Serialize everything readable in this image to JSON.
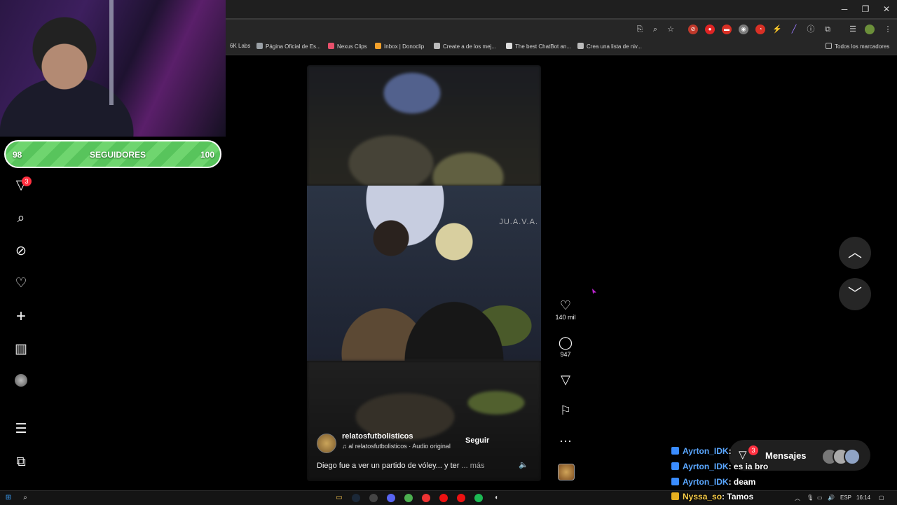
{
  "window_controls": {
    "minimize": "─",
    "maximize": "❐",
    "close": "✕"
  },
  "bookmarks": [
    {
      "label": "6K Labs",
      "color": "#777777"
    },
    {
      "label": "Página Oficial de Es...",
      "color": "#9aa0a6"
    },
    {
      "label": "Nexus Clips",
      "color": "#e8506b"
    },
    {
      "label": "Inbox | Donoclip",
      "color": "#f2a12b"
    },
    {
      "label": "Create a de los mej...",
      "color": "#bbbbbb"
    },
    {
      "label": "The best ChatBot an...",
      "color": "#dddddd"
    },
    {
      "label": "Crea una lista de niv...",
      "color": "#bbbbbb"
    }
  ],
  "bookmarks_all": "Todos los marcadores",
  "follow_goal": {
    "current": "98",
    "label": "SEGUIDORES",
    "target": "100",
    "progress": 0.98
  },
  "ig_nav": {
    "notifications_badge": "3"
  },
  "reel": {
    "watermark": "JU.A.V.A.",
    "username": "relatosfutbolisticos",
    "audio": "♫ al  relatosfutbolisticos · Audio original",
    "follow_label": "Seguir",
    "caption": "Diego fue a ver un partido de vóley... y ter",
    "caption_more": "... más",
    "likes": "140 mil",
    "comments": "947"
  },
  "messages": {
    "label": "Mensajes",
    "badge": "3"
  },
  "chat": [
    {
      "user": "Ayrton_IDK",
      "text": ": ",
      "badge_color": "#3a8cff",
      "vip": false
    },
    {
      "user": "Ayrton_IDK",
      "text": ": es ia bro",
      "badge_color": "#3a8cff",
      "vip": false
    },
    {
      "user": "Ayrton_IDK",
      "text": ": deam",
      "badge_color": "#3a8cff",
      "vip": false
    },
    {
      "user": "Nyssa_so",
      "text": ": Tamos",
      "badge_color": "#e8b020",
      "vip": true
    }
  ],
  "taskbar": {
    "lang": "ESP",
    "time": "16:14"
  }
}
